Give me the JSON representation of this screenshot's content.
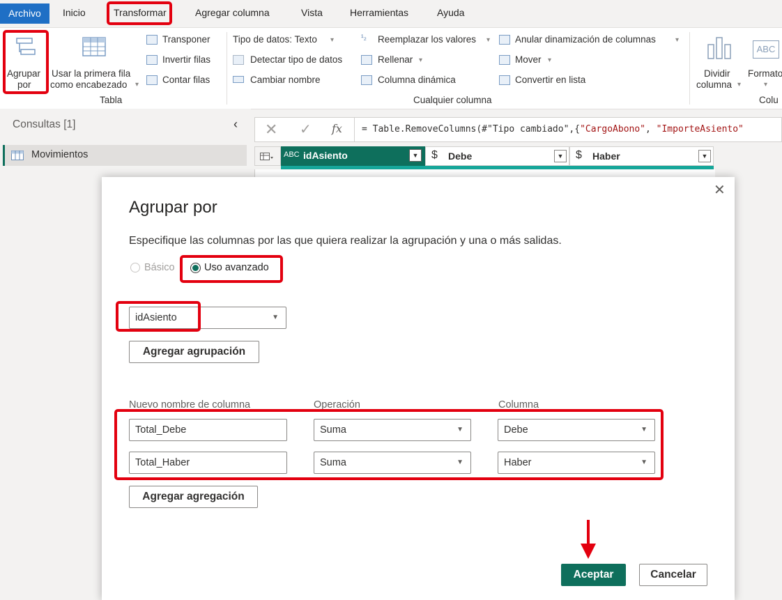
{
  "menu": {
    "tabs": [
      "Archivo",
      "Inicio",
      "Transformar",
      "Agregar columna",
      "Vista",
      "Herramientas",
      "Ayuda"
    ]
  },
  "ribbon": {
    "agrupar": {
      "line1": "Agrupar",
      "line2": "por"
    },
    "primera_fila": {
      "line1": "Usar la primera fila",
      "line2": "como encabezado"
    },
    "transponer": "Transponer",
    "invertir": "Invertir filas",
    "contar": "Contar filas",
    "group_tabla": "Tabla",
    "tipo_datos": "Tipo de datos: Texto",
    "detectar": "Detectar tipo de datos",
    "cambiar_nombre": "Cambiar nombre",
    "reemplazar": "Reemplazar los valores",
    "rellenar": "Rellenar",
    "columna_dinamica": "Columna dinámica",
    "anular": "Anular dinamización de columnas",
    "mover": "Mover",
    "convertir": "Convertir en lista",
    "group_cualquier": "Cualquier columna",
    "dividir": {
      "line1": "Dividir",
      "line2": "columna"
    },
    "formato": "Formato",
    "group_colu": "Colu"
  },
  "left": {
    "header": "Consultas [1]",
    "query": "Movimientos"
  },
  "formula": {
    "fx": "fx",
    "prefix": "= Table.RemoveColumns(#\"Tipo cambiado\",{",
    "s1": "\"CargoAbono\"",
    "sep": ", ",
    "s2": "\"ImporteAsiento\""
  },
  "grid": {
    "columns": [
      {
        "type": "ABC",
        "name": "idAsiento"
      },
      {
        "type": "$",
        "name": "Debe"
      },
      {
        "type": "$",
        "name": "Haber"
      }
    ]
  },
  "dialog": {
    "title": "Agrupar por",
    "description": "Especifique las columnas por las que quiera realizar la agrupación y una o más salidas.",
    "radio_basic": "Básico",
    "radio_advanced": "Uso avanzado",
    "group_field": "idAsiento",
    "add_group": "Agregar agrupación",
    "col_new": "Nuevo nombre de columna",
    "col_op": "Operación",
    "col_col": "Columna",
    "rows": [
      {
        "name": "Total_Debe",
        "op": "Suma",
        "col": "Debe"
      },
      {
        "name": "Total_Haber",
        "op": "Suma",
        "col": "Haber"
      }
    ],
    "add_agg": "Agregar agregación",
    "ok": "Aceptar",
    "cancel": "Cancelar"
  },
  "colors": {
    "accent_teal": "#0e6f5c",
    "annotation_red": "#e3000f",
    "archivo_blue": "#1f6fc5"
  }
}
